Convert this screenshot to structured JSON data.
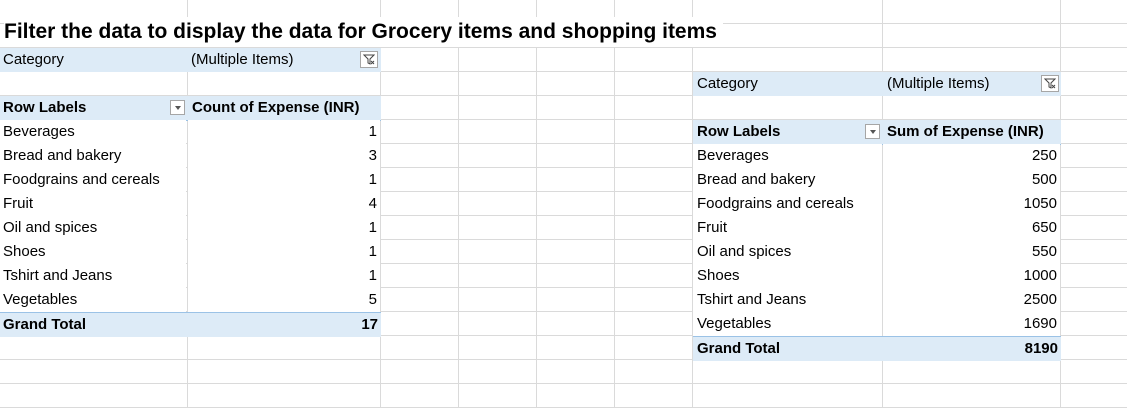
{
  "title": "Filter the data to display the data for Grocery items and shopping items",
  "pivot_count": {
    "filter_label": "Category",
    "filter_value": "(Multiple Items)",
    "row_labels_header": "Row Labels",
    "value_header": "Count of Expense (INR)",
    "rows": [
      {
        "label": "Beverages",
        "value": "1"
      },
      {
        "label": "Bread and bakery",
        "value": "3"
      },
      {
        "label": "Foodgrains and cereals",
        "value": "1"
      },
      {
        "label": "Fruit",
        "value": "4"
      },
      {
        "label": "Oil and spices",
        "value": "1"
      },
      {
        "label": "Shoes",
        "value": "1"
      },
      {
        "label": "Tshirt and Jeans",
        "value": "1"
      },
      {
        "label": "Vegetables",
        "value": "5"
      }
    ],
    "grand_total_label": "Grand Total",
    "grand_total_value": "17"
  },
  "pivot_sum": {
    "filter_label": "Category",
    "filter_value": "(Multiple Items)",
    "row_labels_header": "Row Labels",
    "value_header": "Sum of Expense (INR)",
    "rows": [
      {
        "label": "Beverages",
        "value": "250"
      },
      {
        "label": "Bread and bakery",
        "value": "500"
      },
      {
        "label": "Foodgrains and cereals",
        "value": "1050"
      },
      {
        "label": "Fruit",
        "value": "650"
      },
      {
        "label": "Oil and spices",
        "value": "550"
      },
      {
        "label": "Shoes",
        "value": "1000"
      },
      {
        "label": "Tshirt and Jeans",
        "value": "2500"
      },
      {
        "label": "Vegetables",
        "value": "1690"
      }
    ],
    "grand_total_label": "Grand Total",
    "grand_total_value": "8190"
  },
  "colors": {
    "pivot_header_fill": "#ddebf7",
    "pivot_border": "#9bc2e6",
    "gridline": "#dadada"
  },
  "icons": {
    "filter_button": "funnel-filter-icon",
    "row_labels_dropdown": "chevron-down-icon"
  }
}
